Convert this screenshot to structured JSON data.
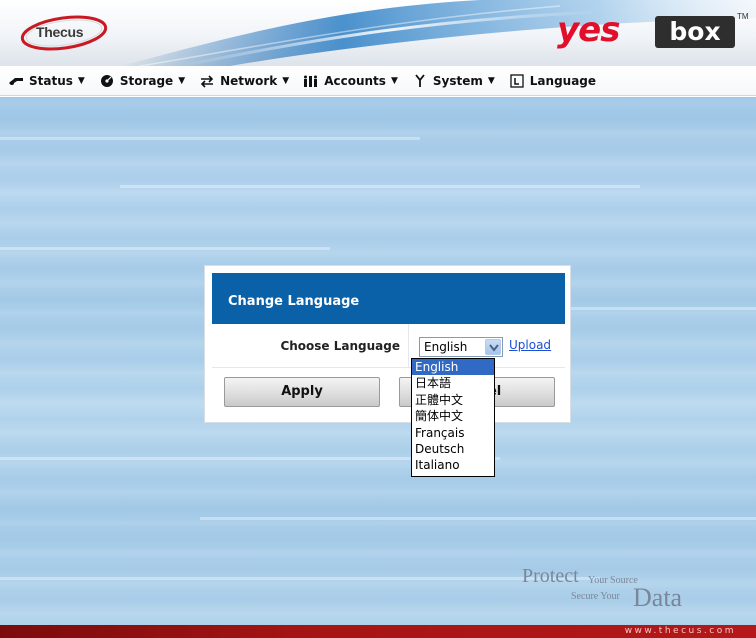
{
  "header": {
    "brand_left": "Thecus",
    "brand_right_yes": "yes",
    "brand_right_box": "box",
    "brand_tm": "TM"
  },
  "nav": {
    "items": [
      {
        "label": "Status",
        "icon": "status-arrow-icon",
        "has_caret": true
      },
      {
        "label": "Storage",
        "icon": "disk-icon",
        "has_caret": true
      },
      {
        "label": "Network",
        "icon": "network-arrows-icon",
        "has_caret": true
      },
      {
        "label": "Accounts",
        "icon": "users-icon",
        "has_caret": true
      },
      {
        "label": "System",
        "icon": "wrench-icon",
        "has_caret": true
      },
      {
        "label": "Language",
        "icon": "language-icon",
        "has_caret": false
      }
    ],
    "caret": "▼"
  },
  "dialog": {
    "title": "Change Language",
    "choose_label": "Choose Language",
    "selected_language": "English",
    "upload_label": "Upload",
    "apply_label": "Apply",
    "cancel_label": "Cancel"
  },
  "dropdown": {
    "options": [
      "English",
      "日本語",
      "正體中文",
      "簡体中文",
      "Français",
      "Deutsch",
      "Italiano"
    ],
    "selected_index": 0
  },
  "branding": {
    "protect": "Protect",
    "your_source": "Your Source",
    "secure_your": "Secure Your",
    "data": "Data",
    "url": "www.thecus.com"
  },
  "colors": {
    "dialog_title_bg": "#0a61a8",
    "selection_bg": "#316ac5",
    "link": "#1a4fd6",
    "footer": "#a51414",
    "brand_red": "#e10f2a"
  }
}
